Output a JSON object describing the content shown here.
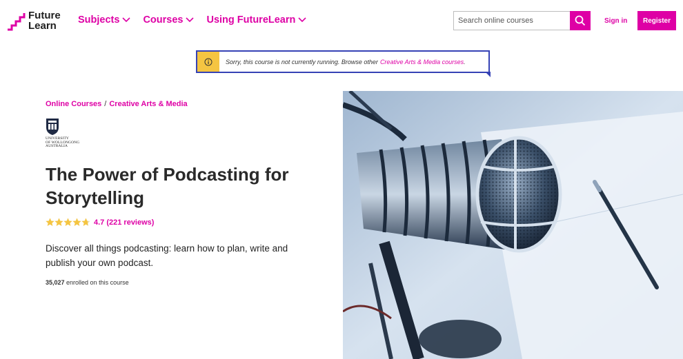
{
  "logo": {
    "line1": "Future",
    "line2": "Learn",
    "accent_color": "#de00a5"
  },
  "nav": {
    "items": [
      {
        "label": "Subjects"
      },
      {
        "label": "Courses"
      },
      {
        "label": "Using FutureLearn"
      }
    ]
  },
  "search": {
    "placeholder": "Search online courses",
    "icon": "search-icon"
  },
  "auth": {
    "signin_label": "Sign in",
    "register_label": "Register"
  },
  "alert": {
    "message": "Sorry, this course is not currently running. Browse other",
    "link": "Creative Arts & Media courses",
    "suffix": ".",
    "icon": "info-icon"
  },
  "breadcrumb": {
    "items": [
      "Online Courses",
      "Creative Arts & Media"
    ],
    "separator": "/"
  },
  "university": {
    "line1": "UNIVERSITY",
    "line2": "OF WOLLONGONG",
    "line3": "AUSTRALIA"
  },
  "course": {
    "title": "The Power of Podcasting for Storytelling",
    "rating": 4.7,
    "rating_text": "4.7 (221 reviews)",
    "description": "Discover all things podcasting: learn how to plan, write and publish your own podcast.",
    "enrolled_count": "35,027",
    "enrolled_suffix": " enrolled on this course"
  },
  "colors": {
    "brand": "#de00a5",
    "alert_border": "#3542b5",
    "alert_icon_bg": "#f5c542",
    "star": "#f5c542"
  }
}
